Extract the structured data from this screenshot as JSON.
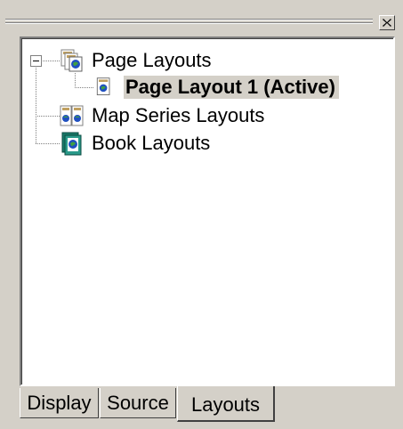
{
  "tree": {
    "items": [
      {
        "label": "Page Layouts",
        "icon": "page-layouts-icon",
        "expanded": true,
        "selected": false
      },
      {
        "label": "Page Layout 1 (Active)",
        "icon": "page-layout-icon",
        "selected": true
      },
      {
        "label": "Map Series Layouts",
        "icon": "map-series-layouts-icon",
        "selected": false
      },
      {
        "label": "Book Layouts",
        "icon": "book-layouts-icon",
        "selected": false
      }
    ]
  },
  "tabs": [
    {
      "label": "Display",
      "active": false
    },
    {
      "label": "Source",
      "active": false
    },
    {
      "label": "Layouts",
      "active": true
    }
  ],
  "colors": {
    "face": "#d4d0c8",
    "shadow": "#808080",
    "dark_shadow": "#404040",
    "highlight": "#ffffff",
    "selection": "#d4d0c8"
  }
}
